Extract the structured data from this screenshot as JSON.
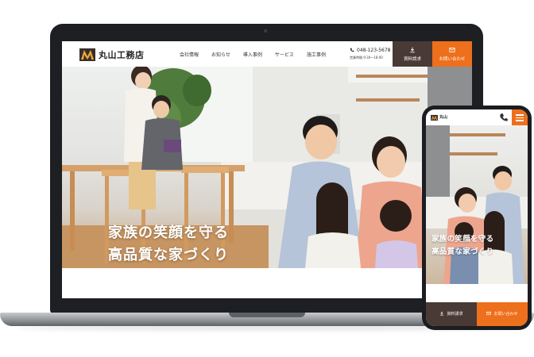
{
  "site": {
    "logo_text": "丸山工務店",
    "nav": [
      "会社情報",
      "お知らせ",
      "導入事例",
      "サービス",
      "施工事例"
    ],
    "phone": "048-123-5678",
    "hours": "営業時間 9:30～18:00",
    "doc_button": "資料請求",
    "contact_button": "お問い合わせ"
  },
  "hero": {
    "line1": "家族の笑顔を守る",
    "line2": "高品質な家づくり"
  },
  "mobile": {
    "logo_text": "丸山",
    "hero_line1": "家族の笑顔を守る",
    "hero_line2": "高品質な家づくり",
    "doc_button": "資料請求",
    "contact_button": "お問い合わせ"
  },
  "colors": {
    "accent": "#ee6f1c",
    "dark_button": "#4a3a36",
    "device_frame": "#1d1f22"
  }
}
